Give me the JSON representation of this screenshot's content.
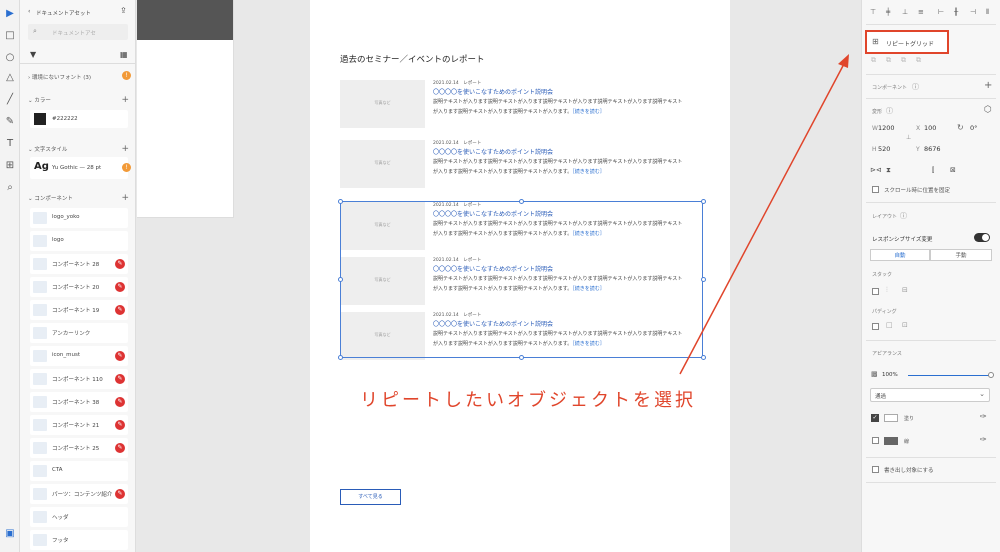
{
  "assets": {
    "title": "ドキュメントアセット",
    "search_placeholder": "ドキュメントアセ",
    "missing_fonts": "環境にないフォント (3)",
    "colors_header": "カラー",
    "color_value": "#222222",
    "char_styles_header": "文字スタイル",
    "char_style_sample": "Ag",
    "char_style_name": "Yu Gothic — 28 pt",
    "components_header": "コンポーネント",
    "components": [
      {
        "label": "logo_yoko",
        "badge": false
      },
      {
        "label": "logo",
        "badge": false
      },
      {
        "label": "コンポーネント 28",
        "badge": true
      },
      {
        "label": "コンポーネント 20",
        "badge": true
      },
      {
        "label": "コンポーネント 19",
        "badge": true
      },
      {
        "label": "アンカーリンク",
        "badge": false
      },
      {
        "label": "icon_must",
        "badge": true
      },
      {
        "label": "コンポーネント 110",
        "badge": true
      },
      {
        "label": "コンポーネント 38",
        "badge": true
      },
      {
        "label": "コンポーネント 21",
        "badge": true
      },
      {
        "label": "コンポーネント 25",
        "badge": true
      },
      {
        "label": "CTA",
        "badge": false
      },
      {
        "label": "パーツ：コンテンツ紹介",
        "badge": true
      },
      {
        "label": "ヘッダ",
        "badge": false
      },
      {
        "label": "フッタ",
        "badge": false
      }
    ]
  },
  "artboard": {
    "heading": "過去のセミナー／イベントのレポート",
    "thumb_label": "写真など",
    "cards": [
      {
        "meta": "2021.02.14　レポート",
        "title": "〇〇〇〇を使いこなすためのポイント説明会",
        "desc1": "説明テキストが入ります説明テキストが入ります説明テキストが入ります説明テキストが入ります説明テキスト",
        "desc2": "が入ります説明テキストが入ります説明テキストが入ります。",
        "more": "［続きを読む］"
      },
      {
        "meta": "2021.02.14　レポート",
        "title": "〇〇〇〇を使いこなすためのポイント説明会",
        "desc1": "説明テキストが入ります説明テキストが入ります説明テキストが入ります説明テキストが入ります説明テキスト",
        "desc2": "が入ります説明テキストが入ります説明テキストが入ります。",
        "more": "［続きを読む］"
      },
      {
        "meta": "2021.02.14　レポート",
        "title": "〇〇〇〇を使いこなすためのポイント説明会",
        "desc1": "説明テキストが入ります説明テキストが入ります説明テキストが入ります説明テキストが入ります説明テキスト",
        "desc2": "が入ります説明テキストが入ります説明テキストが入ります。",
        "more": "［続きを読む］"
      },
      {
        "meta": "2021.02.14　レポート",
        "title": "〇〇〇〇を使いこなすためのポイント説明会",
        "desc1": "説明テキストが入ります説明テキストが入ります説明テキストが入ります説明テキストが入ります説明テキスト",
        "desc2": "が入ります説明テキストが入ります説明テキストが入ります。",
        "more": "［続きを読む］"
      },
      {
        "meta": "2021.02.14　レポート",
        "title": "〇〇〇〇を使いこなすためのポイント説明会",
        "desc1": "説明テキストが入ります説明テキストが入ります説明テキストが入ります説明テキストが入ります説明テキスト",
        "desc2": "が入ります説明テキストが入ります説明テキストが入ります。",
        "more": "［続きを読む］"
      }
    ],
    "see_all_button": "すべて見る",
    "annotation": "リピートしたいオブジェクトを選択"
  },
  "props": {
    "repeat_grid_button": "リピートグリッド",
    "component_header": "コンポーネント",
    "transform_header": "変形",
    "w_label": "W",
    "w_value": "1200",
    "x_label": "X",
    "x_value": "100",
    "rotation_value": "0°",
    "h_label": "H",
    "h_value": "520",
    "y_label": "Y",
    "y_value": "8676",
    "fix_on_scroll": "スクロール時に位置を固定",
    "layout_header": "レイアウト",
    "responsive_resize": "レスポンシブサイズ変更",
    "auto_label": "自動",
    "manual_label": "手動",
    "stack_header": "スタック",
    "padding_header": "パディング",
    "appearance_header": "アピアランス",
    "opacity_value": "100%",
    "blend_mode": "通過",
    "fill_label": "塗り",
    "border_label": "線",
    "export_target": "書き出し対象にする"
  },
  "colors": {
    "accent": "#e0452b",
    "selection": "#4a7fd6",
    "link": "#2a5cb8",
    "swatch": "#222222"
  }
}
